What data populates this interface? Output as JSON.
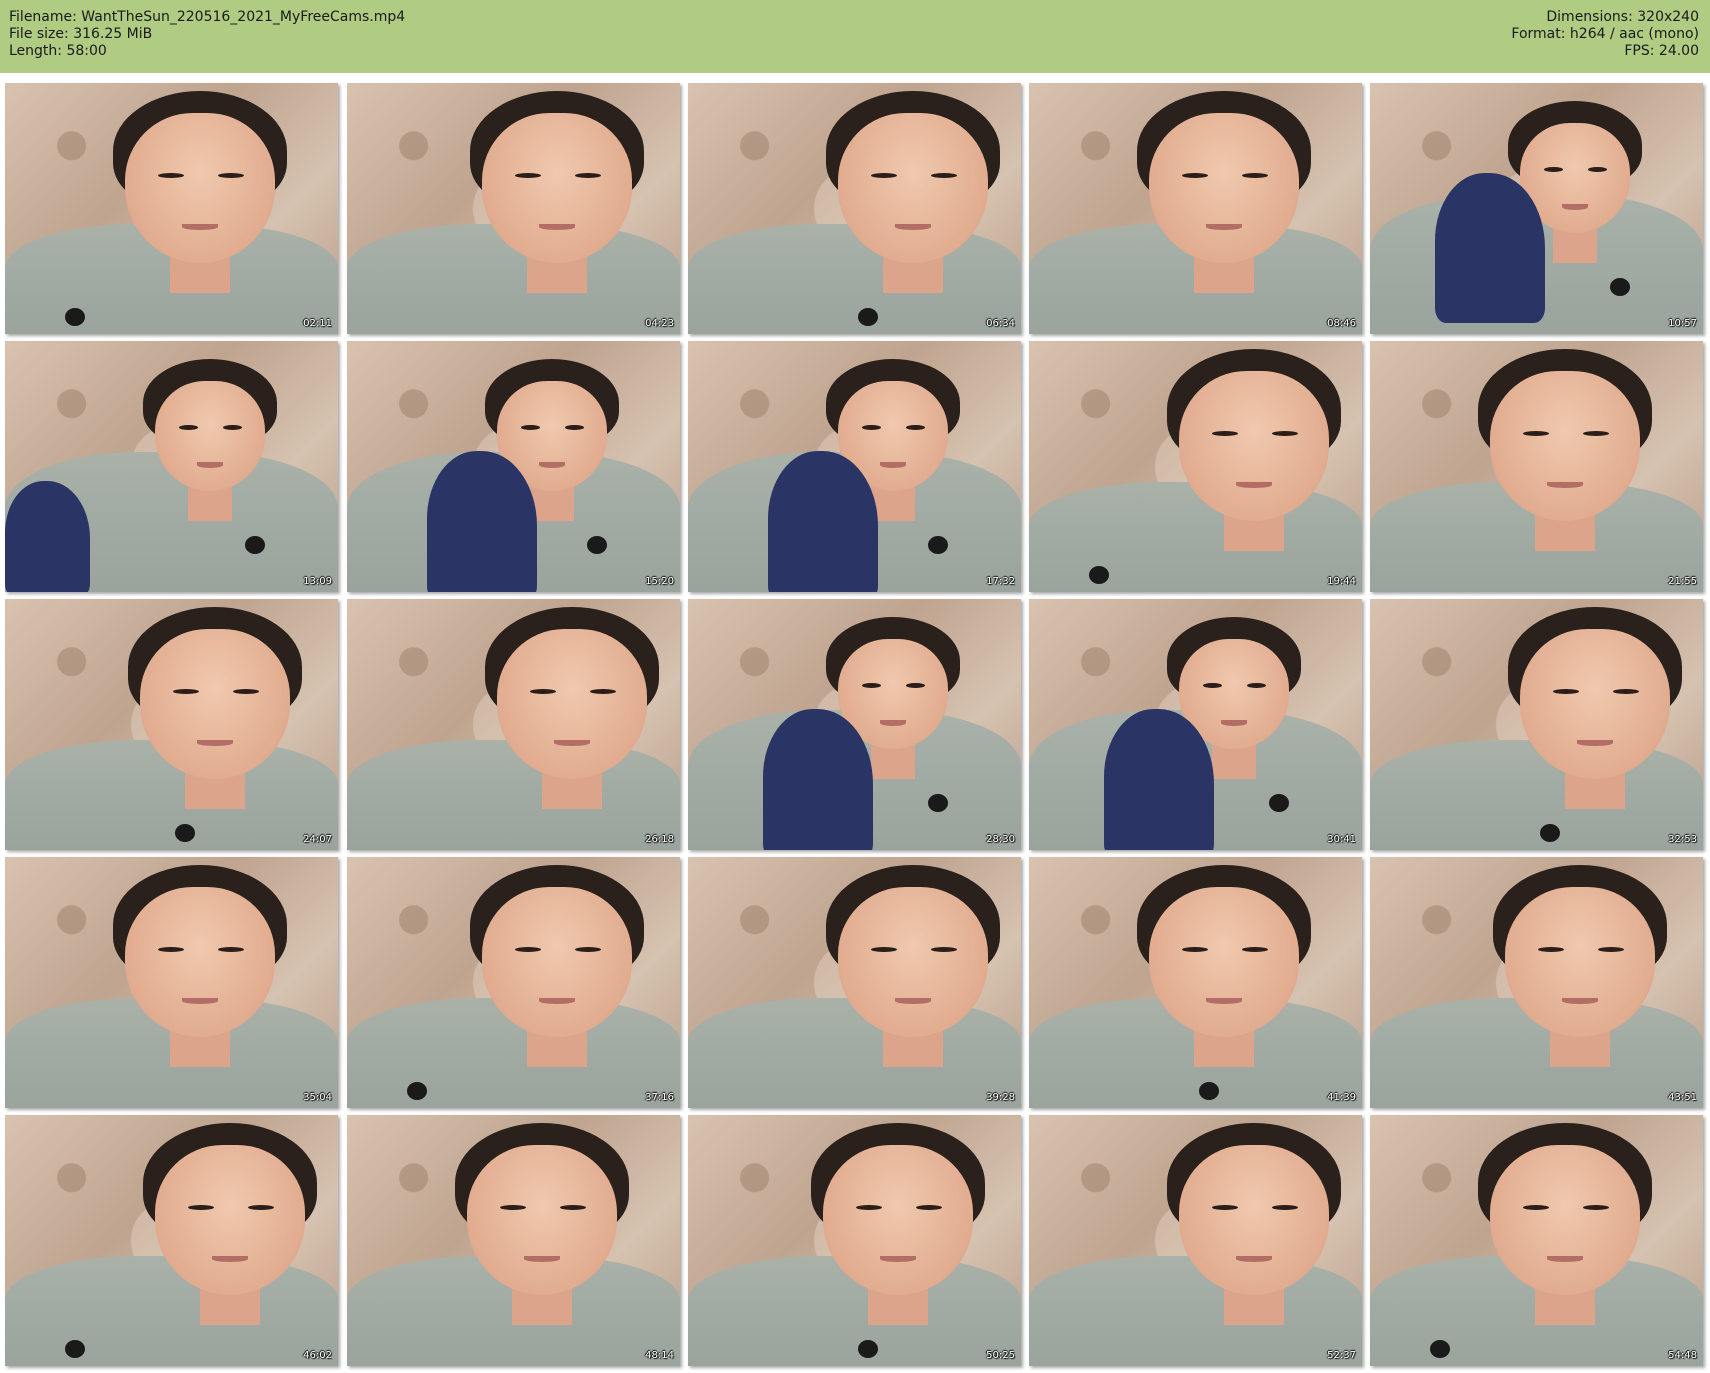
{
  "header": {
    "filename": "Filename: WantTheSun_220516_2021_MyFreeCams.mp4",
    "filesize": "File size: 316.25 MiB",
    "length": "Length: 58:00",
    "dimensions": "Dimensions: 320x240",
    "format": "Format: h264 / aac (mono)",
    "fps": "FPS: 24.00"
  },
  "colors": {
    "header_bg": "#b0cc82",
    "sweater": "#a9b1a9",
    "leggings": "#2a3566"
  },
  "thumbnails": [
    {
      "time": "02:11"
    },
    {
      "time": "04:23"
    },
    {
      "time": "06:34"
    },
    {
      "time": "08:46"
    },
    {
      "time": "10:57"
    },
    {
      "time": "13:09"
    },
    {
      "time": "15:20"
    },
    {
      "time": "17:32"
    },
    {
      "time": "19:44"
    },
    {
      "time": "21:55"
    },
    {
      "time": "24:07"
    },
    {
      "time": "26:18"
    },
    {
      "time": "28:30"
    },
    {
      "time": "30:41"
    },
    {
      "time": "32:53"
    },
    {
      "time": "35:04"
    },
    {
      "time": "37:16"
    },
    {
      "time": "39:28"
    },
    {
      "time": "41:39"
    },
    {
      "time": "43:51"
    },
    {
      "time": "46:02"
    },
    {
      "time": "48:14"
    },
    {
      "time": "50:25"
    },
    {
      "time": "52:37"
    },
    {
      "time": "54:48"
    }
  ]
}
